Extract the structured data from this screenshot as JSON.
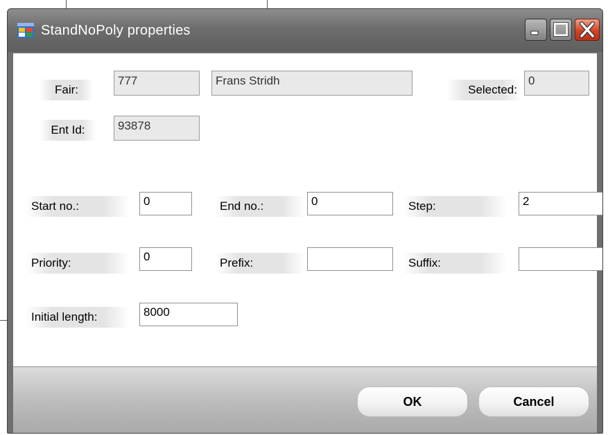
{
  "window": {
    "title": "StandNoPoly properties",
    "icon": "form-app-icon",
    "controls": [
      "minimize-icon",
      "maximize-icon",
      "close-icon"
    ]
  },
  "info": {
    "fair_label": "Fair:",
    "fair_id": "777",
    "fair_name": "Frans Stridh",
    "selected_label": "Selected:",
    "selected_value": "0",
    "entid_label": "Ent Id:",
    "entid_value": "93878"
  },
  "fields": {
    "start_no": {
      "label": "Start no.:",
      "value": "0"
    },
    "end_no": {
      "label": "End no.:",
      "value": "0"
    },
    "step": {
      "label": "Step:",
      "value": "2"
    },
    "priority": {
      "label": "Priority:",
      "value": "0"
    },
    "prefix": {
      "label": "Prefix:",
      "value": ""
    },
    "suffix": {
      "label": "Suffix:",
      "value": ""
    },
    "initial_length": {
      "label": "Initial length:",
      "value": "8000"
    }
  },
  "buttons": {
    "ok": "OK",
    "cancel": "Cancel"
  },
  "colors": {
    "titlebar": "#6d6d6d",
    "close_button": "#d24422",
    "client_bg": "#ffffff"
  }
}
